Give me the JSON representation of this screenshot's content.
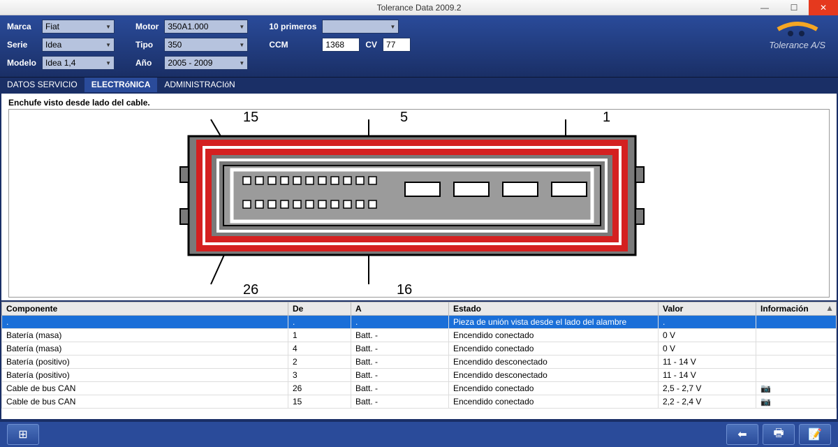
{
  "window": {
    "title": "Tolerance Data 2009.2"
  },
  "brand": {
    "name": "Tolerance A/S"
  },
  "filters": {
    "marca_label": "Marca",
    "marca_value": "Fiat",
    "serie_label": "Serie",
    "serie_value": "Idea",
    "modelo_label": "Modelo",
    "modelo_value": "Idea 1,4",
    "motor_label": "Motor",
    "motor_value": "350A1.000",
    "tipo_label": "Tipo",
    "tipo_value": "350",
    "ano_label": "Año",
    "ano_value": "2005 - 2009",
    "primeros_label": "10 primeros",
    "primeros_value": "",
    "ccm_label": "CCM",
    "ccm_value": "1368",
    "cv_label": "CV",
    "cv_value": "77"
  },
  "tabs": {
    "t1": "DATOS SERVICIO",
    "t2": "ELECTRóNICA",
    "t3": "ADMINISTRACIóN"
  },
  "diagram": {
    "caption": "Enchufe visto desde lado del cable.",
    "pins": {
      "p15": "15",
      "p5": "5",
      "p1": "1",
      "p26": "26",
      "p16": "16"
    }
  },
  "table": {
    "headers": {
      "c1": "Componente",
      "c2": "De",
      "c3": "A",
      "c4": "Estado",
      "c5": "Valor",
      "c6": "Información"
    },
    "rows": [
      {
        "c1": ".",
        "c2": ".",
        "c3": ".",
        "c4": "Pieza de unión vista desde el lado del alambre",
        "c5": ".",
        "c6": "",
        "hl": true
      },
      {
        "c1": "Batería (masa)",
        "c2": "1",
        "c3": "Batt. -",
        "c4": "Encendido conectado",
        "c5": "0 V",
        "c6": ""
      },
      {
        "c1": "Batería (masa)",
        "c2": "4",
        "c3": "Batt. -",
        "c4": "Encendido conectado",
        "c5": "0 V",
        "c6": ""
      },
      {
        "c1": "Batería (positivo)",
        "c2": "2",
        "c3": "Batt. -",
        "c4": "Encendido desconectado",
        "c5": "11 - 14 V",
        "c6": ""
      },
      {
        "c1": "Batería (positivo)",
        "c2": "3",
        "c3": "Batt. -",
        "c4": "Encendido desconectado",
        "c5": "11 - 14 V",
        "c6": ""
      },
      {
        "c1": "Cable de bus CAN",
        "c2": "26",
        "c3": "Batt. -",
        "c4": "Encendido conectado",
        "c5": "2,5 - 2,7 V",
        "c6": "📷"
      },
      {
        "c1": "Cable de bus CAN",
        "c2": "15",
        "c3": "Batt. -",
        "c4": "Encendido conectado",
        "c5": "2,2 - 2,4 V",
        "c6": "📷"
      }
    ]
  },
  "footer_icons": {
    "left": "diagram-icon",
    "back": "back-icon",
    "print": "print-icon",
    "note": "note-icon"
  }
}
